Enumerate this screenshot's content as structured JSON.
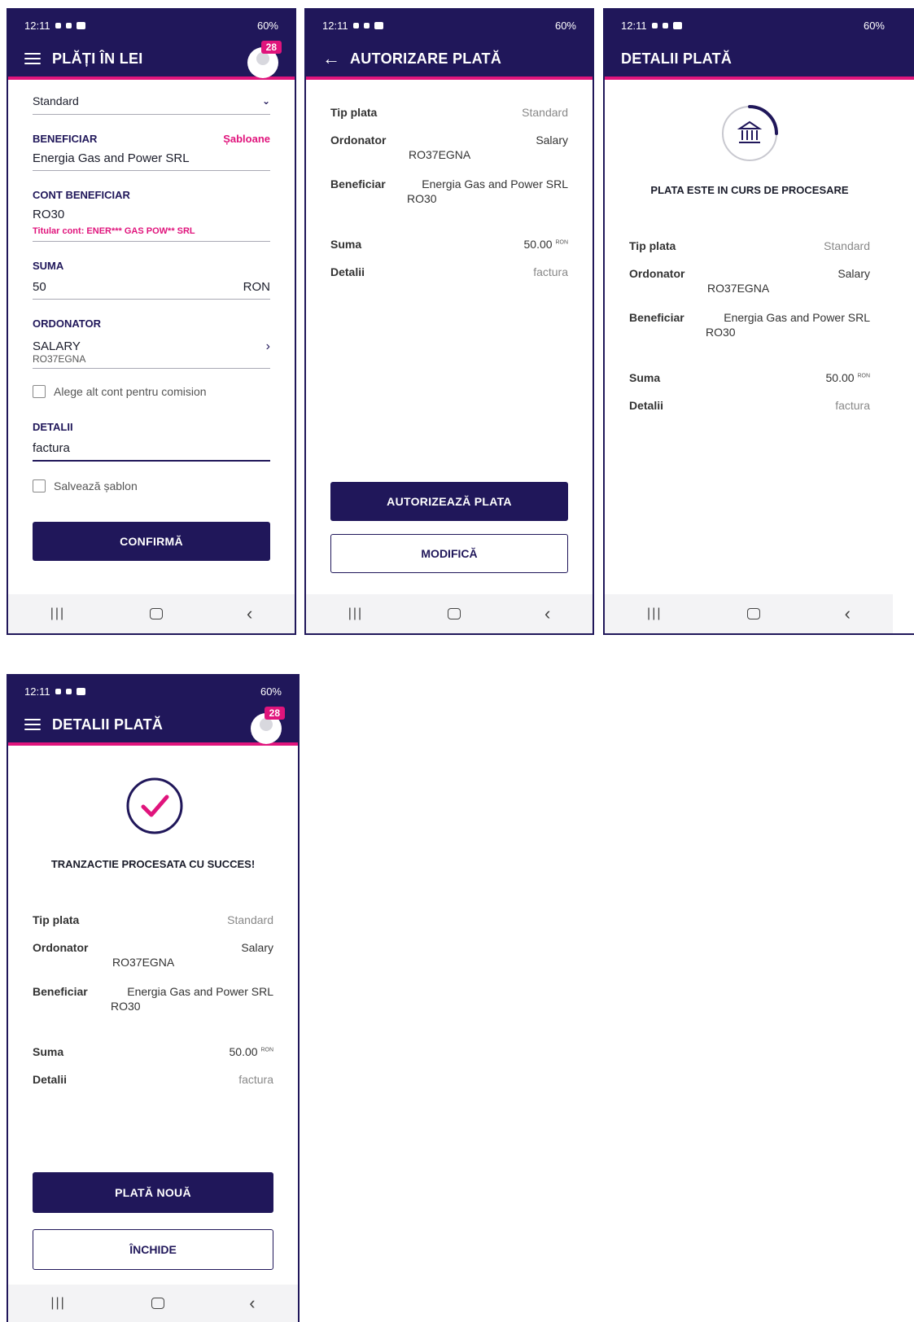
{
  "status": {
    "time": "12:11",
    "battery": "60%"
  },
  "screen1": {
    "title": "PLĂȚI ÎN LEI",
    "badge": "28",
    "payment_type": "Standard",
    "beneficiar_label": "BENEFICIAR",
    "sabloane_link": "Șabloane",
    "beneficiar_value": "Energia Gas and Power SRL",
    "cont_label": "CONT BENEFICIAR",
    "cont_value": "RO30",
    "titular": "Titular cont: ENER*** GAS POW** SRL",
    "suma_label": "SUMA",
    "suma_value": "50",
    "currency": "RON",
    "ordonator_label": "ORDONATOR",
    "ordonator_name": "SALARY",
    "ordonator_iban": "RO37EGNA",
    "alt_cont": "Alege alt cont pentru comision",
    "detalii_label": "DETALII",
    "detalii_value": "factura",
    "salveaza": "Salvează șablon",
    "confirm_button": "CONFIRMĂ"
  },
  "screen2": {
    "title": "AUTORIZARE PLATĂ",
    "authorize_button": "AUTORIZEAZĂ PLATA",
    "modify_button": "MODIFICĂ"
  },
  "screen3": {
    "title": "DETALII PLATĂ",
    "message": "PLATA ESTE IN CURS DE PROCESARE"
  },
  "screen4": {
    "title": "DETALII PLATĂ",
    "badge": "28",
    "message": "TRANZACTIE PROCESATA CU SUCCES!",
    "new_button": "PLATĂ NOUĂ",
    "close_button": "ÎNCHIDE"
  },
  "details": {
    "tip_label": "Tip plata",
    "tip_value": "Standard",
    "ordonator_label": "Ordonator",
    "ordonator_value": "Salary",
    "ordonator_iban": "RO37EGNA",
    "beneficiar_label": "Beneficiar",
    "beneficiar_value": "Energia Gas and Power SRL",
    "beneficiar_iban": "RO30",
    "suma_label": "Suma",
    "suma_value": "50.00",
    "suma_currency": "RON",
    "detalii_label": "Detalii",
    "detalii_value": "factura"
  },
  "colors": {
    "primary": "#20175a",
    "accent": "#e0147c"
  }
}
